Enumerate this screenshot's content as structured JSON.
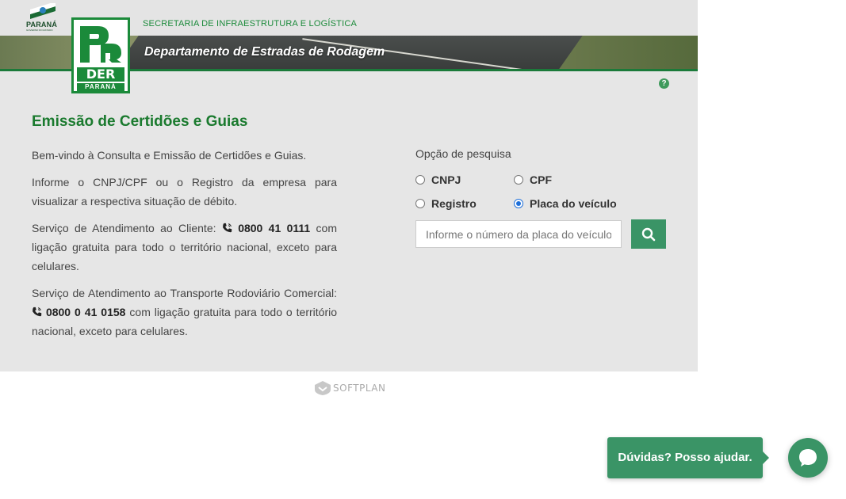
{
  "header": {
    "parana_logo_text": "PARANÁ",
    "parana_logo_sub": "GOVERNO DO ESTADO",
    "secretaria": "SECRETARIA DE INFRAESTRUTURA E LOGÍSTICA",
    "departamento": "Departamento de Estradas de Rodagem",
    "der_logo_text": "DER",
    "der_logo_state": "PARANÁ"
  },
  "help_icon": "question-icon",
  "page_title": "Emissão de Certidões e Guias",
  "intro": {
    "welcome": "Bem-vindo à Consulta e Emissão de Certidões e Guias.",
    "inform": "Informe o CNPJ/CPF ou o Registro da empresa para visualizar a respectiva situação de débito.",
    "service1_prefix": "Serviço de Atendimento ao Cliente:",
    "service1_phone": "0800 41 0111",
    "service1_suffix": "com ligação gratuita para todo o território nacional, exceto para celulares.",
    "service2_prefix": "Serviço de Atendimento ao Transporte Rodoviário Comercial:",
    "service2_phone": "0800 0 41 0158",
    "service2_suffix": "com ligação gratuita para todo o território nacional, exceto para celulares."
  },
  "search": {
    "label": "Opção de pesquisa",
    "options": [
      {
        "label": "CNPJ",
        "checked": false
      },
      {
        "label": "CPF",
        "checked": false
      },
      {
        "label": "Registro",
        "checked": false
      },
      {
        "label": "Placa do veículo",
        "checked": true
      }
    ],
    "placeholder": "Informe o número da placa do veículo",
    "value": ""
  },
  "footer": {
    "brand": "SOFTPLAN"
  },
  "chat": {
    "label": "Dúvidas? Posso ajudar."
  },
  "colors": {
    "brand_green": "#1a7a2e",
    "button_green": "#3a9466",
    "panel_bg": "#e6e6e6"
  }
}
